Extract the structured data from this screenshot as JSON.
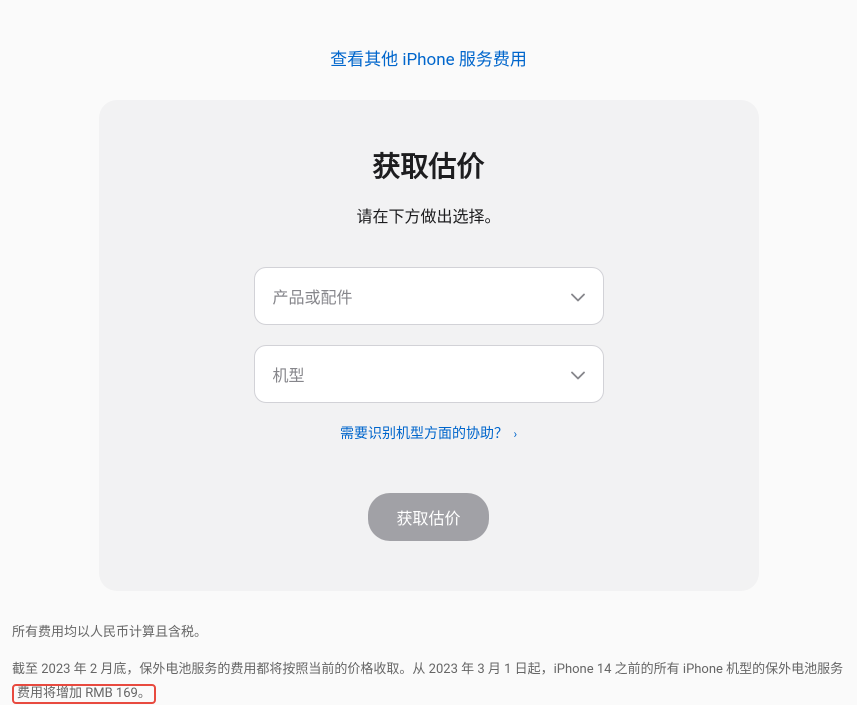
{
  "topLink": {
    "label": "查看其他 iPhone 服务费用"
  },
  "card": {
    "title": "获取估价",
    "subtitle": "请在下方做出选择。",
    "selectProduct": {
      "placeholder": "产品或配件"
    },
    "selectModel": {
      "placeholder": "机型"
    },
    "helpLink": {
      "label": "需要识别机型方面的协助？"
    },
    "submitButton": {
      "label": "获取估价"
    }
  },
  "footnotes": {
    "line1": "所有费用均以人民币计算且含税。",
    "line2_part1": "截至 2023 年 2 月底，保外电池服务的费用都将按照当前的价格收取。从 2023 年 3 月 1 日起，iPhone 14 之前的所有 iPhone 机型的保外电池服务",
    "line2_highlighted": "费用将增加 RMB 169。"
  }
}
